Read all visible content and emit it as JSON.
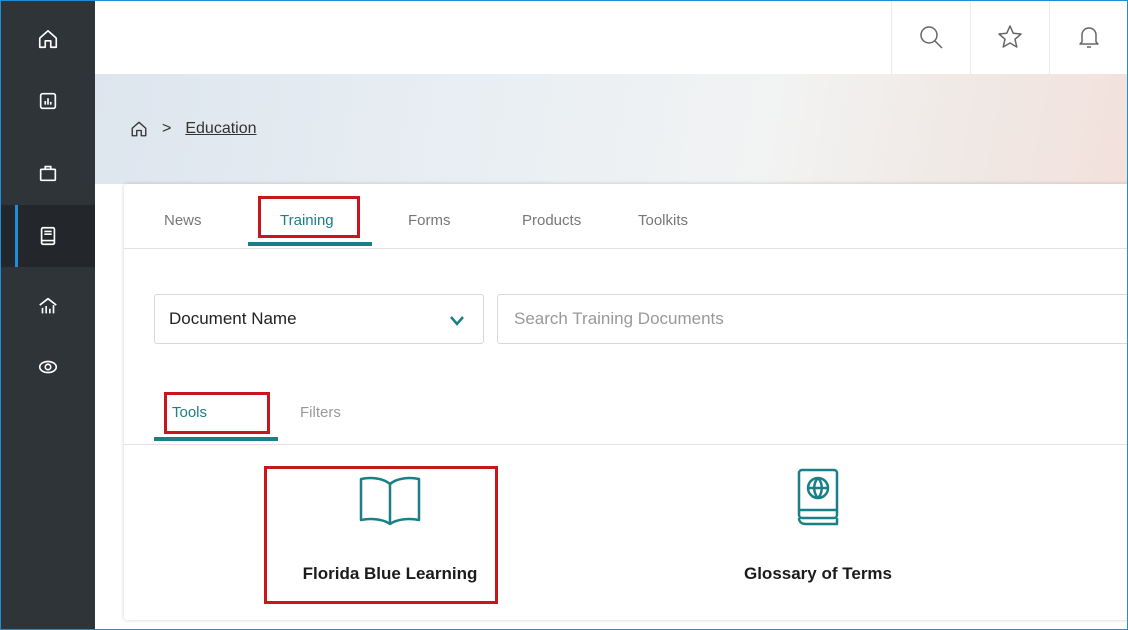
{
  "sidebar": {
    "items": [
      {
        "icon": "home-icon"
      },
      {
        "icon": "dashboard-chart-icon"
      },
      {
        "icon": "briefcase-icon"
      },
      {
        "icon": "book-icon",
        "active": true
      },
      {
        "icon": "analytics-icon"
      },
      {
        "icon": "eye-icon"
      }
    ]
  },
  "topbar": {
    "icons": [
      "search-icon",
      "star-icon",
      "bell-icon"
    ]
  },
  "breadcrumb": {
    "home_icon": "home-icon",
    "separator": ">",
    "current": "Education"
  },
  "tabs": [
    {
      "label": "News"
    },
    {
      "label": "Training",
      "active": true
    },
    {
      "label": "Forms"
    },
    {
      "label": "Products"
    },
    {
      "label": "Toolkits"
    }
  ],
  "search": {
    "select_value": "Document Name",
    "placeholder": "Search Training Documents"
  },
  "subtabs": [
    {
      "label": "Tools",
      "active": true
    },
    {
      "label": "Filters"
    }
  ],
  "tools": [
    {
      "label": "Florida Blue Learning",
      "icon": "open-book-icon"
    },
    {
      "label": "Glossary of Terms",
      "icon": "globe-book-icon"
    }
  ],
  "colors": {
    "accent": "#1a7f86",
    "highlight": "#c8161d",
    "sidebar": "#2f3439",
    "frame": "#1e8fd6"
  }
}
